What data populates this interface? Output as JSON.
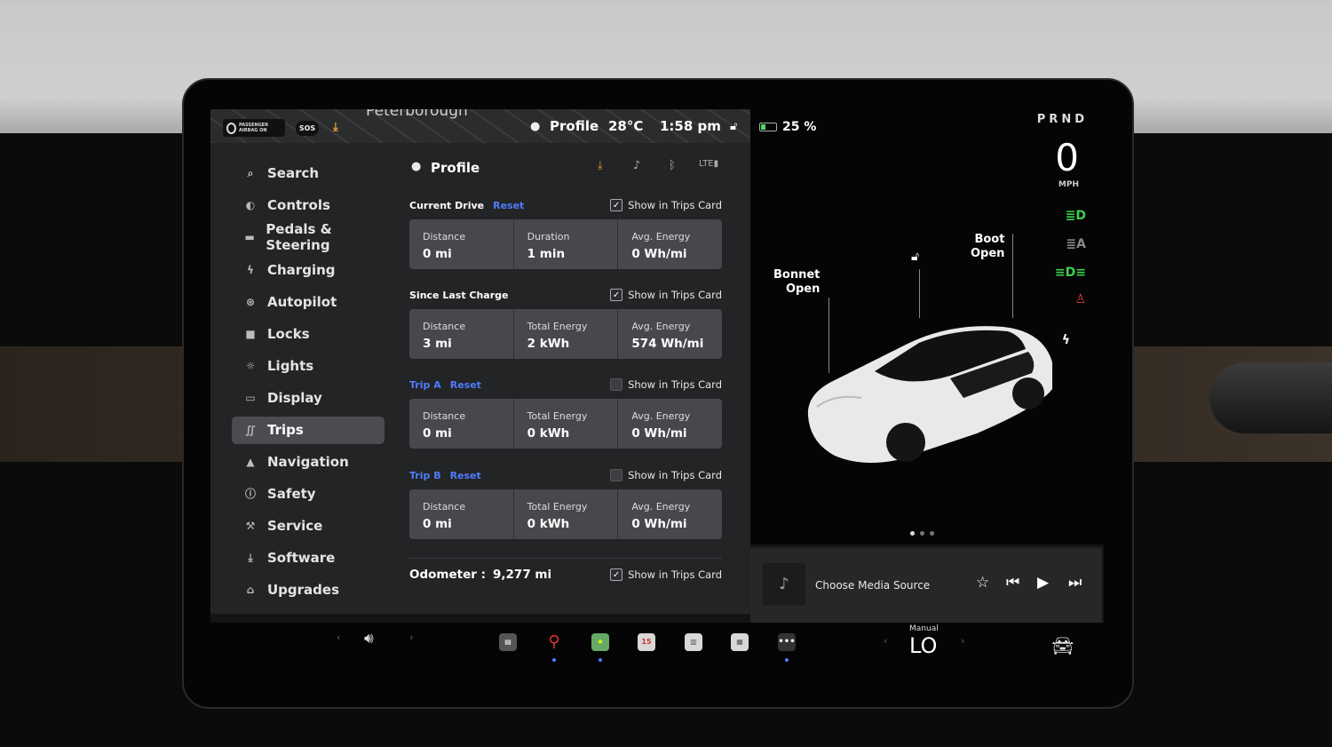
{
  "status_bar": {
    "airbag_label": "PASSENGER AIRBAG ON",
    "sos_label": "SOS",
    "map_label": "Peterborough",
    "profile_label": "Profile",
    "temperature": "28°C",
    "time": "1:58 pm"
  },
  "sidebar": {
    "items": [
      {
        "label": "Search",
        "icon": "search-icon"
      },
      {
        "label": "Controls",
        "icon": "toggle-icon"
      },
      {
        "label": "Pedals & Steering",
        "icon": "car-icon"
      },
      {
        "label": "Charging",
        "icon": "bolt-icon"
      },
      {
        "label": "Autopilot",
        "icon": "steering-wheel-icon"
      },
      {
        "label": "Locks",
        "icon": "lock-icon"
      },
      {
        "label": "Lights",
        "icon": "sun-icon"
      },
      {
        "label": "Display",
        "icon": "display-icon"
      },
      {
        "label": "Trips",
        "icon": "trips-icon",
        "active": true
      },
      {
        "label": "Navigation",
        "icon": "navigation-icon"
      },
      {
        "label": "Safety",
        "icon": "safety-icon"
      },
      {
        "label": "Service",
        "icon": "wrench-icon"
      },
      {
        "label": "Software",
        "icon": "download-icon"
      },
      {
        "label": "Upgrades",
        "icon": "bag-icon"
      }
    ]
  },
  "main": {
    "title": "Profile",
    "show_label": "Show in Trips Card",
    "reset_label": "Reset",
    "current_drive": {
      "title": "Current Drive",
      "show_checked": true,
      "cells": [
        {
          "label": "Distance",
          "value": "0 mi"
        },
        {
          "label": "Duration",
          "value": "1 min"
        },
        {
          "label": "Avg. Energy",
          "value": "0 Wh/mi"
        }
      ]
    },
    "since_last_charge": {
      "title": "Since Last Charge",
      "show_checked": true,
      "cells": [
        {
          "label": "Distance",
          "value": "3 mi"
        },
        {
          "label": "Total Energy",
          "value": "2 kWh"
        },
        {
          "label": "Avg. Energy",
          "value": "574 Wh/mi"
        }
      ]
    },
    "trip_a": {
      "title": "Trip A",
      "show_checked": false,
      "cells": [
        {
          "label": "Distance",
          "value": "0 mi"
        },
        {
          "label": "Total Energy",
          "value": "0 kWh"
        },
        {
          "label": "Avg. Energy",
          "value": "0 Wh/mi"
        }
      ]
    },
    "trip_b": {
      "title": "Trip B",
      "show_checked": false,
      "cells": [
        {
          "label": "Distance",
          "value": "0 mi"
        },
        {
          "label": "Total Energy",
          "value": "0 kWh"
        },
        {
          "label": "Avg. Energy",
          "value": "0 Wh/mi"
        }
      ]
    },
    "odometer": {
      "label": "Odometer :",
      "value": "9,277 mi",
      "show_checked": true
    }
  },
  "vehicle": {
    "battery_percent": "25 %",
    "battery_level": 0.25,
    "gear": "PRND",
    "speed": "0",
    "speed_unit": "MPH",
    "bonnet_label": "Bonnet",
    "bonnet_state": "Open",
    "boot_label": "Boot",
    "boot_state": "Open"
  },
  "media": {
    "source_label": "Choose Media Source"
  },
  "bottom_bar": {
    "calendar_day": "15",
    "climate_mode": "Manual",
    "climate_temp": "LO"
  },
  "colors": {
    "accent": "#4f7cff",
    "battery": "#4cd964",
    "download": "#e8a030",
    "telltale_green": "#3ccf4e",
    "telltale_red": "#e23b3b"
  }
}
